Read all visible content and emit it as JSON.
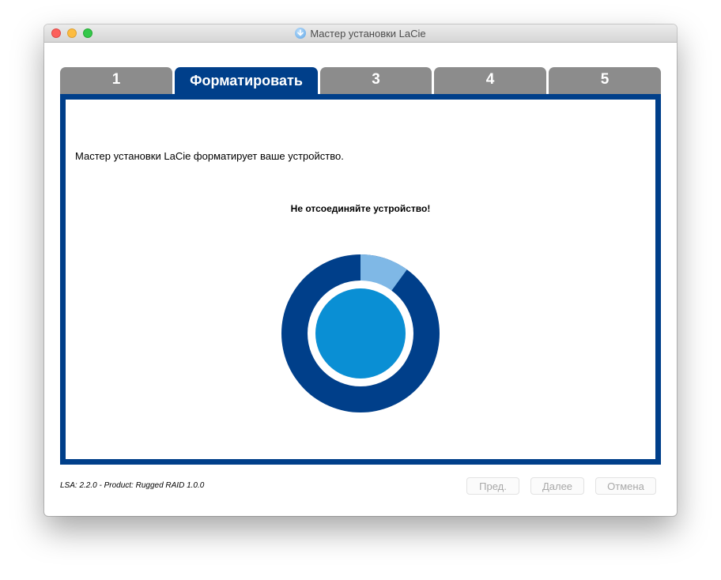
{
  "window": {
    "title": "Мастер установки LaCie",
    "title_icon": "download-arrow-icon"
  },
  "tabs": [
    {
      "label": "1",
      "active": false
    },
    {
      "label": "Форматировать",
      "active": true
    },
    {
      "label": "3",
      "active": false
    },
    {
      "label": "4",
      "active": false
    },
    {
      "label": "5",
      "active": false
    }
  ],
  "panel": {
    "message": "Мастер установки LaCie форматирует ваше устройство.",
    "warning": "Не отсоединяйте устройство!",
    "progress_fraction": 0.1,
    "colors": {
      "ring": "#003f8a",
      "progress": "#7fb8e6",
      "center": "#0a8fd4",
      "tab_inactive": "#8c8c8c",
      "tab_active": "#003f8a"
    }
  },
  "footer": {
    "version": "LSA: 2.2.0 - Product: Rugged RAID 1.0.0",
    "prev_label": "Пред.",
    "next_label": "Далее",
    "cancel_label": "Отмена"
  }
}
